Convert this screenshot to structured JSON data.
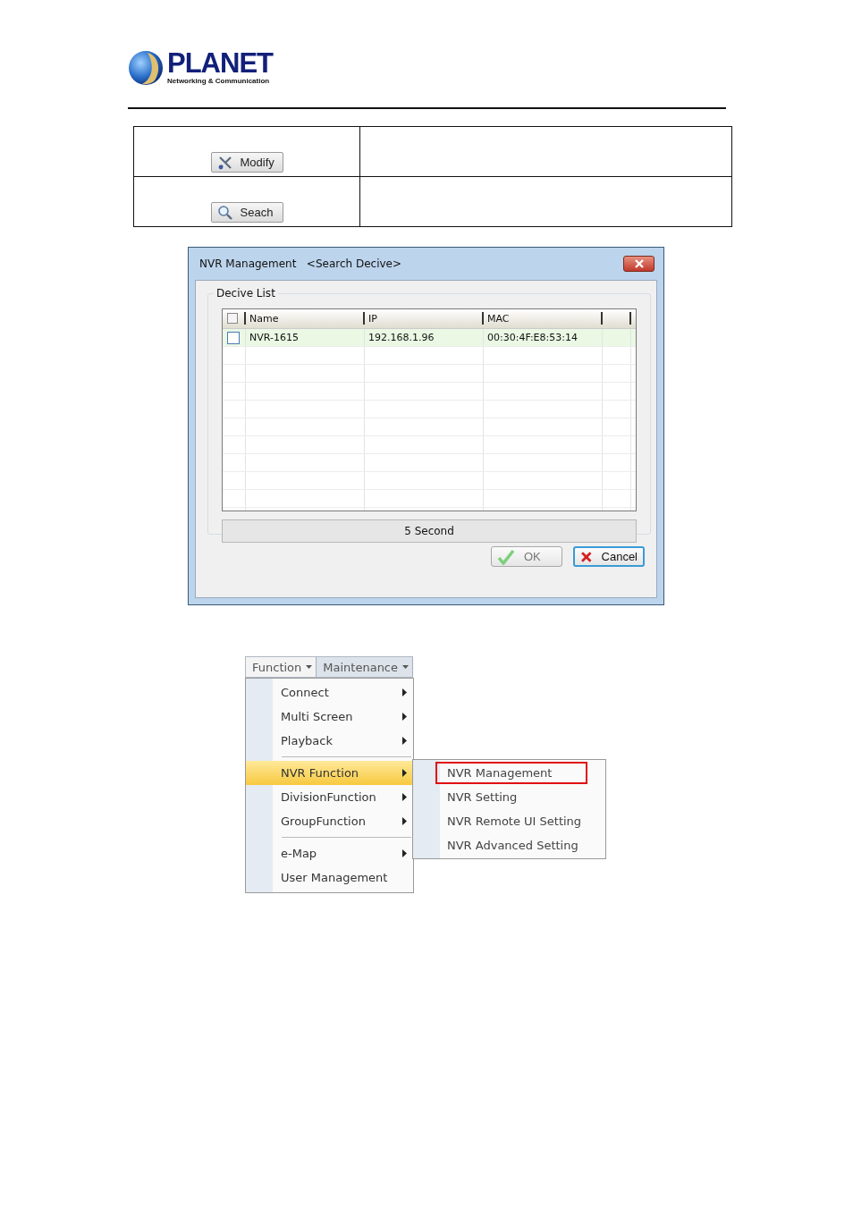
{
  "logo": {
    "name": "PLANET",
    "tagline": "Networking & Communication"
  },
  "button_table": {
    "rows": [
      {
        "kind": "modify",
        "button": "Modify"
      },
      {
        "kind": "search",
        "button": "Seach"
      }
    ]
  },
  "dialog": {
    "title": "NVR Management",
    "subtitle": "<Search Decive>",
    "group_label": "Decive List",
    "header_checked": false,
    "columns": [
      "Name",
      "IP",
      "MAC"
    ],
    "rows": [
      {
        "checked": false,
        "selected": true,
        "name": "NVR-1615",
        "ip": "192.168.1.96",
        "mac": "00:30:4F:E8:53:14"
      }
    ],
    "progress_label": "5 Second",
    "buttons": [
      {
        "kind": "ok",
        "label": "OK",
        "disabled": true
      },
      {
        "kind": "cancel",
        "label": "Cancel",
        "disabled": false
      }
    ]
  },
  "menu": {
    "tabs": [
      {
        "label": "Function",
        "selected": true
      },
      {
        "label": "Maintenance",
        "selected": false
      }
    ],
    "items": [
      {
        "kind": "item",
        "label": "Connect",
        "submenu": true,
        "selected": false
      },
      {
        "kind": "item",
        "label": "Multi Screen",
        "submenu": true,
        "selected": false
      },
      {
        "kind": "item",
        "label": "Playback",
        "submenu": true,
        "selected": false
      },
      {
        "kind": "separator"
      },
      {
        "kind": "item",
        "label": "NVR Function",
        "submenu": true,
        "selected": true
      },
      {
        "kind": "item",
        "label": "DivisionFunction",
        "submenu": true,
        "selected": false
      },
      {
        "kind": "item",
        "label": "GroupFunction",
        "submenu": true,
        "selected": false
      },
      {
        "kind": "separator"
      },
      {
        "kind": "item",
        "label": "e-Map",
        "submenu": true,
        "selected": false
      },
      {
        "kind": "item",
        "label": "User Management",
        "submenu": false,
        "selected": false
      }
    ],
    "submenu": [
      {
        "label": "NVR Management",
        "outlined": true
      },
      {
        "label": "NVR Setting",
        "outlined": false
      },
      {
        "label": "NVR Remote UI Setting",
        "outlined": false
      },
      {
        "label": "NVR Advanced Setting",
        "outlined": false
      }
    ]
  }
}
